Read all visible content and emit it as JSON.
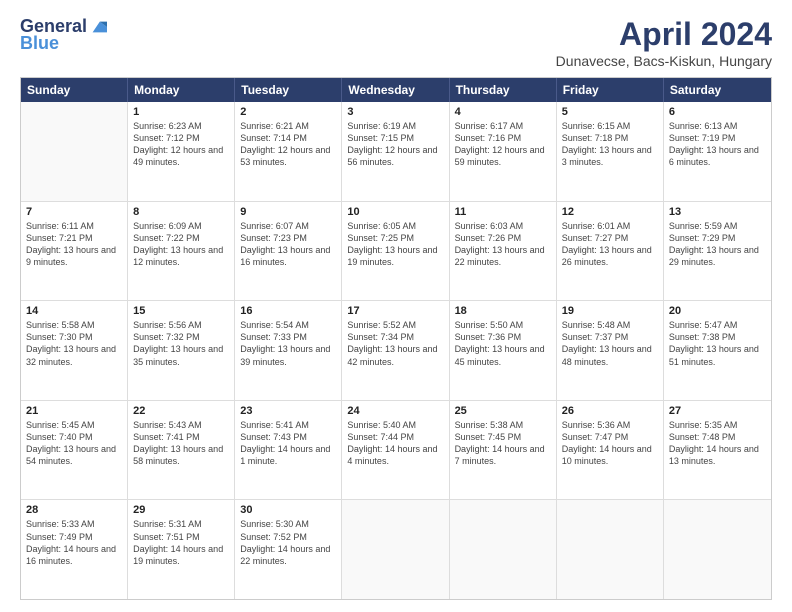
{
  "header": {
    "logo": {
      "general": "General",
      "blue": "Blue",
      "tagline": "GeneralBlue"
    },
    "title": "April 2024",
    "location": "Dunavecse, Bacs-Kiskun, Hungary"
  },
  "days_of_week": [
    "Sunday",
    "Monday",
    "Tuesday",
    "Wednesday",
    "Thursday",
    "Friday",
    "Saturday"
  ],
  "weeks": [
    [
      {
        "day": "",
        "sunrise": "",
        "sunset": "",
        "daylight": ""
      },
      {
        "day": "1",
        "sunrise": "Sunrise: 6:23 AM",
        "sunset": "Sunset: 7:12 PM",
        "daylight": "Daylight: 12 hours and 49 minutes."
      },
      {
        "day": "2",
        "sunrise": "Sunrise: 6:21 AM",
        "sunset": "Sunset: 7:14 PM",
        "daylight": "Daylight: 12 hours and 53 minutes."
      },
      {
        "day": "3",
        "sunrise": "Sunrise: 6:19 AM",
        "sunset": "Sunset: 7:15 PM",
        "daylight": "Daylight: 12 hours and 56 minutes."
      },
      {
        "day": "4",
        "sunrise": "Sunrise: 6:17 AM",
        "sunset": "Sunset: 7:16 PM",
        "daylight": "Daylight: 12 hours and 59 minutes."
      },
      {
        "day": "5",
        "sunrise": "Sunrise: 6:15 AM",
        "sunset": "Sunset: 7:18 PM",
        "daylight": "Daylight: 13 hours and 3 minutes."
      },
      {
        "day": "6",
        "sunrise": "Sunrise: 6:13 AM",
        "sunset": "Sunset: 7:19 PM",
        "daylight": "Daylight: 13 hours and 6 minutes."
      }
    ],
    [
      {
        "day": "7",
        "sunrise": "Sunrise: 6:11 AM",
        "sunset": "Sunset: 7:21 PM",
        "daylight": "Daylight: 13 hours and 9 minutes."
      },
      {
        "day": "8",
        "sunrise": "Sunrise: 6:09 AM",
        "sunset": "Sunset: 7:22 PM",
        "daylight": "Daylight: 13 hours and 12 minutes."
      },
      {
        "day": "9",
        "sunrise": "Sunrise: 6:07 AM",
        "sunset": "Sunset: 7:23 PM",
        "daylight": "Daylight: 13 hours and 16 minutes."
      },
      {
        "day": "10",
        "sunrise": "Sunrise: 6:05 AM",
        "sunset": "Sunset: 7:25 PM",
        "daylight": "Daylight: 13 hours and 19 minutes."
      },
      {
        "day": "11",
        "sunrise": "Sunrise: 6:03 AM",
        "sunset": "Sunset: 7:26 PM",
        "daylight": "Daylight: 13 hours and 22 minutes."
      },
      {
        "day": "12",
        "sunrise": "Sunrise: 6:01 AM",
        "sunset": "Sunset: 7:27 PM",
        "daylight": "Daylight: 13 hours and 26 minutes."
      },
      {
        "day": "13",
        "sunrise": "Sunrise: 5:59 AM",
        "sunset": "Sunset: 7:29 PM",
        "daylight": "Daylight: 13 hours and 29 minutes."
      }
    ],
    [
      {
        "day": "14",
        "sunrise": "Sunrise: 5:58 AM",
        "sunset": "Sunset: 7:30 PM",
        "daylight": "Daylight: 13 hours and 32 minutes."
      },
      {
        "day": "15",
        "sunrise": "Sunrise: 5:56 AM",
        "sunset": "Sunset: 7:32 PM",
        "daylight": "Daylight: 13 hours and 35 minutes."
      },
      {
        "day": "16",
        "sunrise": "Sunrise: 5:54 AM",
        "sunset": "Sunset: 7:33 PM",
        "daylight": "Daylight: 13 hours and 39 minutes."
      },
      {
        "day": "17",
        "sunrise": "Sunrise: 5:52 AM",
        "sunset": "Sunset: 7:34 PM",
        "daylight": "Daylight: 13 hours and 42 minutes."
      },
      {
        "day": "18",
        "sunrise": "Sunrise: 5:50 AM",
        "sunset": "Sunset: 7:36 PM",
        "daylight": "Daylight: 13 hours and 45 minutes."
      },
      {
        "day": "19",
        "sunrise": "Sunrise: 5:48 AM",
        "sunset": "Sunset: 7:37 PM",
        "daylight": "Daylight: 13 hours and 48 minutes."
      },
      {
        "day": "20",
        "sunrise": "Sunrise: 5:47 AM",
        "sunset": "Sunset: 7:38 PM",
        "daylight": "Daylight: 13 hours and 51 minutes."
      }
    ],
    [
      {
        "day": "21",
        "sunrise": "Sunrise: 5:45 AM",
        "sunset": "Sunset: 7:40 PM",
        "daylight": "Daylight: 13 hours and 54 minutes."
      },
      {
        "day": "22",
        "sunrise": "Sunrise: 5:43 AM",
        "sunset": "Sunset: 7:41 PM",
        "daylight": "Daylight: 13 hours and 58 minutes."
      },
      {
        "day": "23",
        "sunrise": "Sunrise: 5:41 AM",
        "sunset": "Sunset: 7:43 PM",
        "daylight": "Daylight: 14 hours and 1 minute."
      },
      {
        "day": "24",
        "sunrise": "Sunrise: 5:40 AM",
        "sunset": "Sunset: 7:44 PM",
        "daylight": "Daylight: 14 hours and 4 minutes."
      },
      {
        "day": "25",
        "sunrise": "Sunrise: 5:38 AM",
        "sunset": "Sunset: 7:45 PM",
        "daylight": "Daylight: 14 hours and 7 minutes."
      },
      {
        "day": "26",
        "sunrise": "Sunrise: 5:36 AM",
        "sunset": "Sunset: 7:47 PM",
        "daylight": "Daylight: 14 hours and 10 minutes."
      },
      {
        "day": "27",
        "sunrise": "Sunrise: 5:35 AM",
        "sunset": "Sunset: 7:48 PM",
        "daylight": "Daylight: 14 hours and 13 minutes."
      }
    ],
    [
      {
        "day": "28",
        "sunrise": "Sunrise: 5:33 AM",
        "sunset": "Sunset: 7:49 PM",
        "daylight": "Daylight: 14 hours and 16 minutes."
      },
      {
        "day": "29",
        "sunrise": "Sunrise: 5:31 AM",
        "sunset": "Sunset: 7:51 PM",
        "daylight": "Daylight: 14 hours and 19 minutes."
      },
      {
        "day": "30",
        "sunrise": "Sunrise: 5:30 AM",
        "sunset": "Sunset: 7:52 PM",
        "daylight": "Daylight: 14 hours and 22 minutes."
      },
      {
        "day": "",
        "sunrise": "",
        "sunset": "",
        "daylight": ""
      },
      {
        "day": "",
        "sunrise": "",
        "sunset": "",
        "daylight": ""
      },
      {
        "day": "",
        "sunrise": "",
        "sunset": "",
        "daylight": ""
      },
      {
        "day": "",
        "sunrise": "",
        "sunset": "",
        "daylight": ""
      }
    ]
  ]
}
